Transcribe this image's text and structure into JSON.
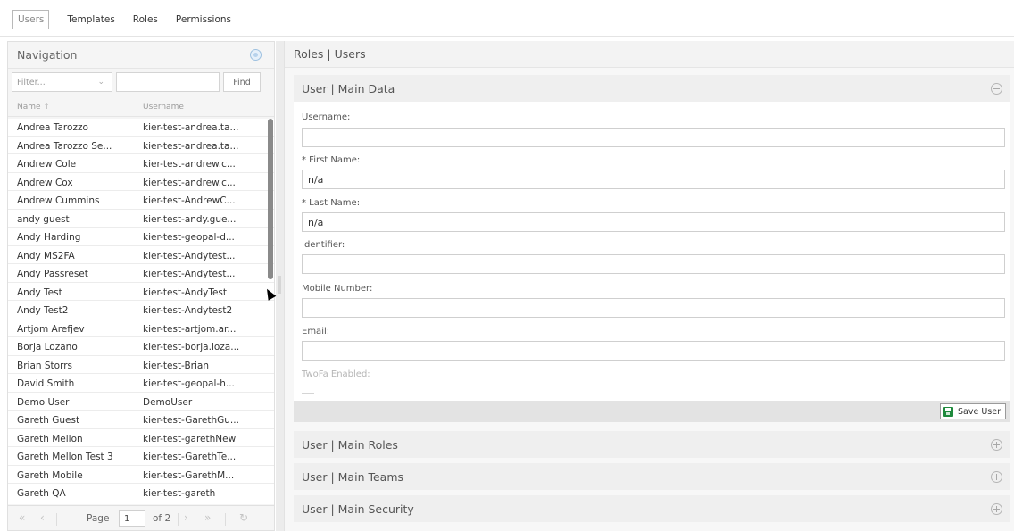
{
  "top_tabs": [
    {
      "label": "Users",
      "active": true
    },
    {
      "label": "Templates",
      "active": false
    },
    {
      "label": "Roles",
      "active": false
    },
    {
      "label": "Permissions",
      "active": false
    }
  ],
  "navigation": {
    "title": "Navigation",
    "filter_select_placeholder": "Filter...",
    "filter_input_value": "",
    "find_label": "Find",
    "columns": {
      "name": "Name ↑",
      "username": "Username"
    },
    "rows": [
      {
        "name": "Andrea Tarozzo",
        "username": "kier-test-andrea.ta..."
      },
      {
        "name": "Andrea Tarozzo Se...",
        "username": "kier-test-andrea.ta..."
      },
      {
        "name": "Andrew Cole",
        "username": "kier-test-andrew.c..."
      },
      {
        "name": "Andrew Cox",
        "username": "kier-test-andrew.c..."
      },
      {
        "name": "Andrew Cummins",
        "username": "kier-test-AndrewC..."
      },
      {
        "name": "andy guest",
        "username": "kier-test-andy.gue..."
      },
      {
        "name": "Andy Harding",
        "username": "kier-test-geopal-d..."
      },
      {
        "name": "Andy MS2FA",
        "username": "kier-test-Andytest..."
      },
      {
        "name": "Andy Passreset",
        "username": "kier-test-Andytest..."
      },
      {
        "name": "Andy Test",
        "username": "kier-test-AndyTest"
      },
      {
        "name": "Andy Test2",
        "username": "kier-test-Andytest2"
      },
      {
        "name": "Artjom Arefjev",
        "username": "kier-test-artjom.ar..."
      },
      {
        "name": "Borja Lozano",
        "username": "kier-test-borja.loza..."
      },
      {
        "name": "Brian Storrs",
        "username": "kier-test-Brian"
      },
      {
        "name": "David Smith",
        "username": "kier-test-geopal-h..."
      },
      {
        "name": "Demo User",
        "username": "DemoUser"
      },
      {
        "name": "Gareth Guest",
        "username": "kier-test-GarethGu..."
      },
      {
        "name": "Gareth Mellon",
        "username": "kier-test-garethNew"
      },
      {
        "name": "Gareth Mellon Test 3",
        "username": "kier-test-GarethTe..."
      },
      {
        "name": "Gareth Mobile",
        "username": "kier-test-GarethM..."
      },
      {
        "name": "Gareth QA",
        "username": "kier-test-gareth"
      }
    ],
    "pager": {
      "page_label": "Page",
      "page_value": "1",
      "of_label": "of 2"
    }
  },
  "main": {
    "breadcrumb": "Roles | Users",
    "main_data": {
      "title": "User | Main Data",
      "fields": [
        {
          "label": "Username:",
          "value": ""
        },
        {
          "label": "* First Name:",
          "value": "n/a"
        },
        {
          "label": "* Last Name:",
          "value": "n/a"
        },
        {
          "label": "Identifier:",
          "value": ""
        },
        {
          "label": "Mobile Number:",
          "value": ""
        },
        {
          "label": "Email:",
          "value": ""
        }
      ],
      "twofa_label": "TwoFa Enabled:"
    },
    "save_label": "Save User",
    "sections": [
      {
        "title": "User | Main Roles"
      },
      {
        "title": "User | Main Teams"
      },
      {
        "title": "User | Main Security"
      }
    ]
  },
  "colors": {
    "save_icon": "#1f8a3d",
    "accent_blue": "#9ec1e0"
  }
}
